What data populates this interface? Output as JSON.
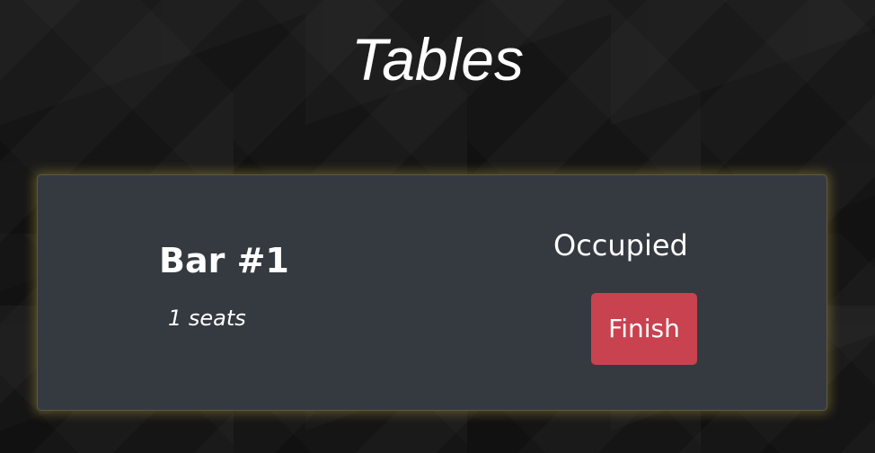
{
  "page": {
    "title": "Tables"
  },
  "tables": [
    {
      "name": "Bar #1",
      "seats": "1 seats",
      "status": "Occupied",
      "action_label": "Finish"
    }
  ],
  "colors": {
    "card_background": "#343a40",
    "card_glow": "#aa963c",
    "finish_button": "#c9424f",
    "page_background": "#151515"
  }
}
